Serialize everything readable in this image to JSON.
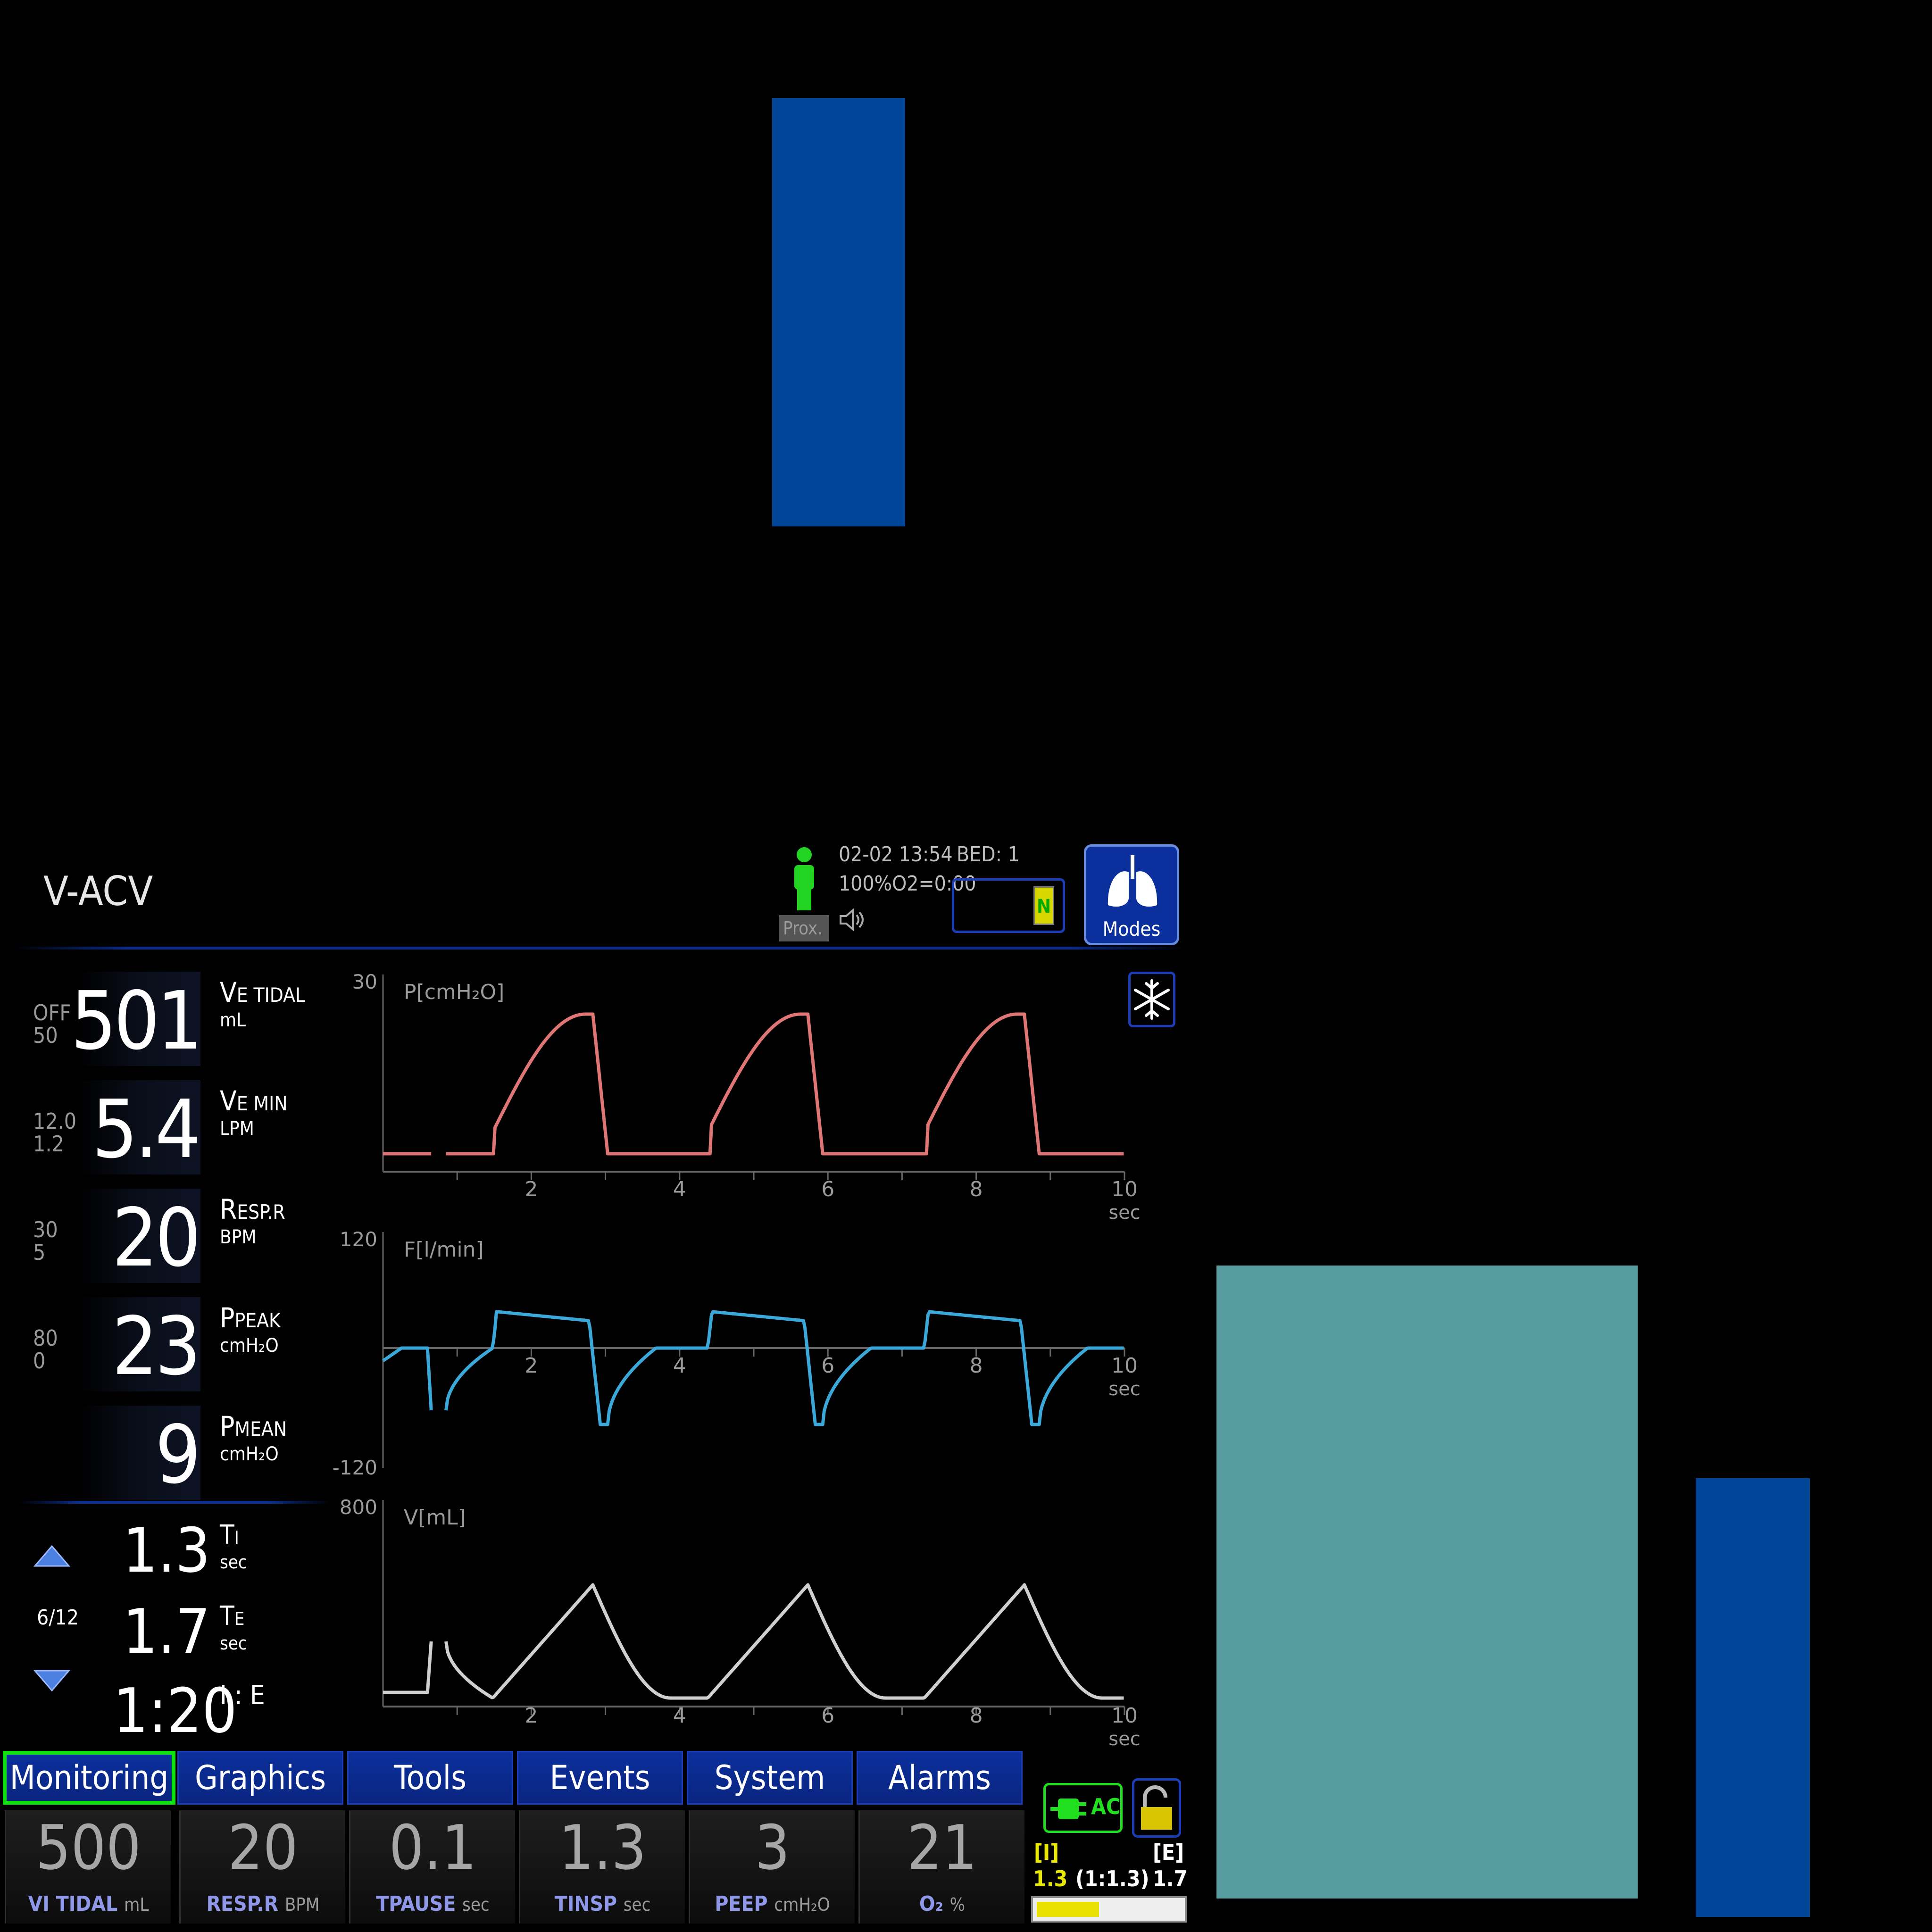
{
  "header": {
    "mode": "V-ACV",
    "datetime": "02-02 13:54",
    "bed": "BED: 1",
    "o2_status": "100%O2=0:00",
    "prox_label": "Prox.",
    "battery_label": "N",
    "modes_label": "Modes"
  },
  "measured": [
    {
      "name": "VE TIDAL",
      "big": "V",
      "small": "E TIDAL",
      "unit": "mL",
      "value": "501",
      "lim_hi": "OFF",
      "lim_lo": "50"
    },
    {
      "name": "VE MIN",
      "big": "V",
      "small": "E MIN",
      "unit": "LPM",
      "value": "5.4",
      "lim_hi": "12.0",
      "lim_lo": "1.2"
    },
    {
      "name": "RESP.R",
      "big": "R",
      "small": "ESP.R",
      "unit": "BPM",
      "value": "20",
      "lim_hi": "30",
      "lim_lo": "5"
    },
    {
      "name": "PPEAK",
      "big": "P",
      "small": "PEAK",
      "unit": "cmH₂O",
      "value": "23",
      "lim_hi": "80",
      "lim_lo": "0"
    },
    {
      "name": "PMEAN",
      "big": "P",
      "small": "MEAN",
      "unit": "cmH₂O",
      "value": "9",
      "lim_hi": "",
      "lim_lo": ""
    }
  ],
  "timing": {
    "ti": {
      "big": "T",
      "small": "I",
      "unit": "sec",
      "value": "1.3"
    },
    "te": {
      "big": "T",
      "small": "E",
      "unit": "sec",
      "value": "1.7"
    },
    "ie": {
      "label": "I : E",
      "value": "1:20"
    },
    "page": "6/12"
  },
  "graphs": {
    "pressure": {
      "label": "P[cmH₂O]",
      "ymax": "30",
      "color": "#e07575"
    },
    "flow": {
      "label": "F[l/min]",
      "ymax": "120",
      "ymin": "-120",
      "color": "#3aa8d8"
    },
    "volume": {
      "label": "V[mL]",
      "ymax": "800",
      "color": "#d0d0d0"
    },
    "x_ticks": [
      "2",
      "4",
      "6",
      "8",
      "10"
    ],
    "x_unit": "sec"
  },
  "tabs": [
    "Monitoring",
    "Graphics",
    "Tools",
    "Events",
    "System",
    "Alarms"
  ],
  "settings": [
    {
      "value": "500",
      "label": "VI TIDAL",
      "unit": "mL"
    },
    {
      "value": "20",
      "label": "RESP.R",
      "unit": "BPM"
    },
    {
      "value": "0.1",
      "label": "TPAUSE",
      "unit": "sec"
    },
    {
      "value": "1.3",
      "label": "TINSP",
      "unit": "sec"
    },
    {
      "value": "3",
      "label": "PEEP",
      "unit": "cmH₂O"
    },
    {
      "value": "21",
      "label": "O₂",
      "unit": "%"
    }
  ],
  "status": {
    "ac_label": "AC",
    "i_label": "[I]",
    "e_label": "[E]",
    "i_value": "1.3",
    "e_value": "1.7",
    "ratio": "(1:1.3)",
    "ie_progress": 0.42
  },
  "colors": {
    "blue_block": "#014598",
    "teal_block": "#579c9f",
    "tab_blue": "#0b2f9c",
    "active_border": "#10e010"
  }
}
